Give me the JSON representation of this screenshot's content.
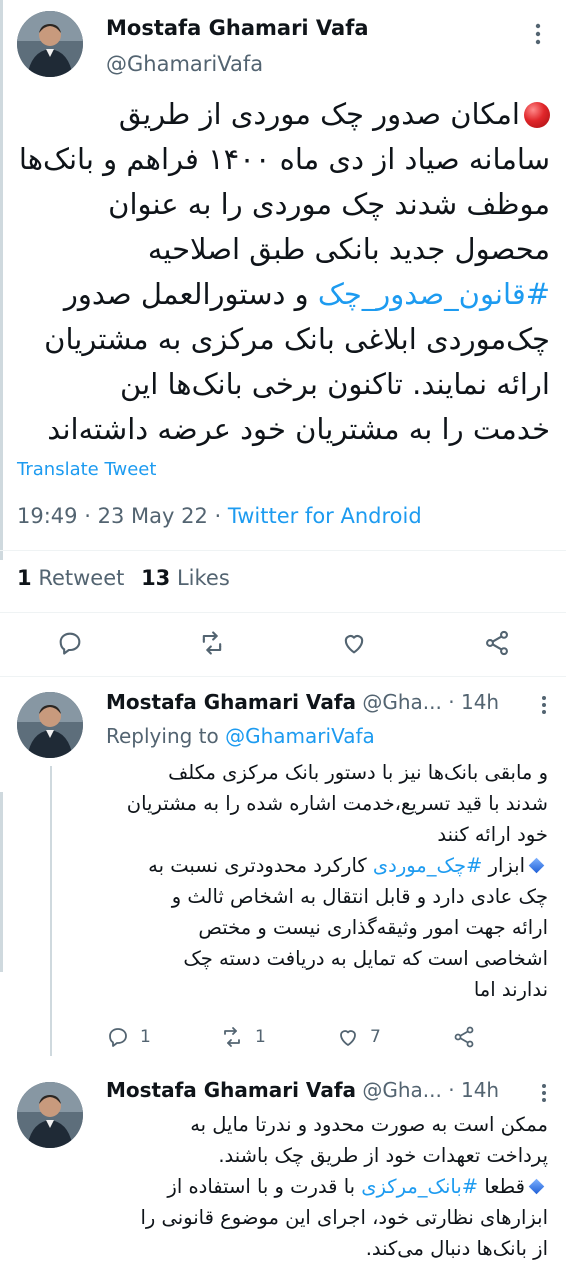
{
  "main_tweet": {
    "author_name": "Mostafa Ghamari Vafa",
    "handle": "@GhamariVafa",
    "text_line_1": "امکان صدور چک موردی از طریق",
    "text_line_2": "سامانه صیاد از دی ماه ۱۴۰۰ فراهم و بانک‌ها",
    "text_line_3": "موظف شدند چک موردی را به عنوان",
    "text_line_4": "محصول جدید بانکی طبق اصلاحیه",
    "hashtag": "#قانون_صدور_چک",
    "text_line_5_rest": " و دستورالعمل صدور",
    "text_line_6": "چک‌موردی ابلاغی بانک مرکزی به مشتریان",
    "text_line_7": "ارائه نمایند. تاکنون برخی بانک‌ها این",
    "text_line_8": "خدمت را به مشتریان خود عرضه داشته‌اند",
    "translate_label": "Translate Tweet",
    "time": "19:49",
    "date": "23 May 22",
    "separator": "·",
    "source": "Twitter for Android",
    "retweets_count": "1",
    "retweets_label": "Retweet",
    "likes_count": "13",
    "likes_label": "Likes"
  },
  "reply_1": {
    "author_name": "Mostafa Ghamari Vafa",
    "handle": "@Gha...",
    "time": "14h",
    "separator": "·",
    "replying_to_label": "Replying to",
    "replying_to_handle": "@GhamariVafa",
    "line_1": "و مابقی بانک‌ها نیز با دستور بانک مرکزی مکلف",
    "line_2": "شدند با قید تسریع،خدمت اشاره شده را به مشتریان",
    "line_3": "خود ارائه کنند",
    "line_4_prefix": "ابزار ",
    "hashtag": "#چک_موردی",
    "line_4_rest": " کارکرد محدودتری نسبت به",
    "line_5": "چک عادی دارد و قابل انتقال به اشخاص ثالث و",
    "line_6": "ارائه جهت امور وثیقه‌گذاری نیست و مختص",
    "line_7": "اشخاصی است که تمایل به دریافت دسته چک",
    "line_8": "ندارند اما",
    "reply_count": "1",
    "retweet_count": "1",
    "like_count": "7"
  },
  "reply_2": {
    "author_name": "Mostafa Ghamari Vafa",
    "handle": "@Gha...",
    "time": "14h",
    "separator": "·",
    "line_1": "ممکن است به صورت محدود و ندرتا مایل به",
    "line_2": "پرداخت تعهدات خود از طریق چک باشند.",
    "line_3_prefix": "قطعا ",
    "hashtag": "#بانک_مرکزی",
    "line_3_rest": " با قدرت و با استفاده از",
    "line_4": "ابزارهای نظارتی خود، اجرای این موضوع قانونی را",
    "line_5": "از بانک‌ها دنبال می‌کند."
  },
  "colors": {
    "link": "#1d9bf0",
    "muted": "#536471",
    "text": "#0f1419",
    "divider": "#eff3f4"
  },
  "icons": [
    "more-icon",
    "reply-icon",
    "retweet-icon",
    "like-icon",
    "share-icon",
    "red-circle-icon",
    "blue-diamond-icon"
  ]
}
